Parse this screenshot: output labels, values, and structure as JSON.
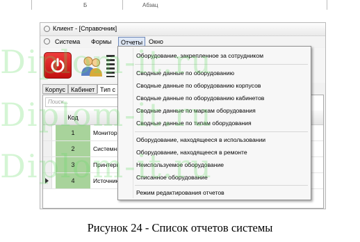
{
  "ruler": {
    "left_label": "Б",
    "right_label": "Абзац"
  },
  "window": {
    "title": "Клиент - [Справочник]",
    "menu": [
      "Система",
      "Формы",
      "Отчеты",
      "Окно"
    ]
  },
  "tabs": [
    "Корпус",
    "Кабинет",
    "Тип с"
  ],
  "grid": {
    "search_placeholder": "Поиск...",
    "code_header": "Код",
    "rows": [
      {
        "code": "1",
        "name": "Мониторы"
      },
      {
        "code": "2",
        "name": "Системны"
      },
      {
        "code": "3",
        "name": "Принтеры"
      },
      {
        "code": "4",
        "name": "Источник"
      }
    ]
  },
  "report_menu": {
    "items": [
      "Оборудование, закрепленное за сотрудником",
      "Сводные данные по оборудованию",
      "Сводные данные по оборудованию корпусов",
      "Сводные данные по оборудованию кабинетов",
      "Сводные данные по маркам оборудования",
      "Сводные данные по типам оборудования",
      "Оборудование, находящееся в использовании",
      "Оборудование, находящееся в ремонте",
      "Неиспользуемое оборудование",
      "Списанное оборудование",
      "Режим редактирования отчетов"
    ]
  },
  "watermark": "Diplom-it.ru",
  "caption": "Рисунок 24 - Список отчетов системы"
}
